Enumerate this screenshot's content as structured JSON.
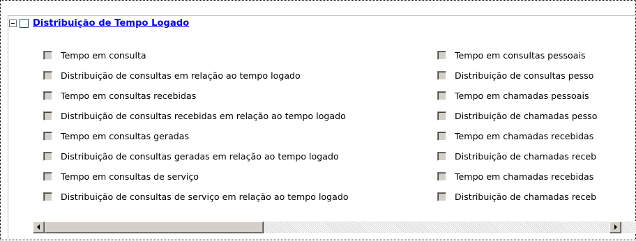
{
  "header": {
    "title": "Distribuição de Tempo Logado"
  },
  "columns": [
    {
      "items": [
        {
          "label": "Tempo em consulta",
          "checked": false
        },
        {
          "label": "Distribuição de consultas em relação ao tempo logado",
          "checked": false
        },
        {
          "label": "Tempo em consultas recebidas",
          "checked": false
        },
        {
          "label": "Distribuição de consultas recebidas em relação ao tempo logado",
          "checked": false
        },
        {
          "label": "Tempo em consultas geradas",
          "checked": false
        },
        {
          "label": "Distribuição de consultas geradas em relação ao tempo logado",
          "checked": false
        },
        {
          "label": "Tempo em consultas de serviço",
          "checked": false
        },
        {
          "label": "Distribuição de consultas de serviço em relação ao tempo logado",
          "checked": false
        }
      ]
    },
    {
      "items": [
        {
          "label": "Tempo em consultas pessoais",
          "checked": false
        },
        {
          "label": "Distribuição de consultas pesso",
          "checked": false
        },
        {
          "label": "Tempo em chamadas pessoais",
          "checked": false
        },
        {
          "label": "Distribuição de chamadas pesso",
          "checked": false
        },
        {
          "label": "Tempo em chamadas recebidas",
          "checked": false
        },
        {
          "label": "Distribuição de chamadas receb",
          "checked": false
        },
        {
          "label": "Tempo em chamadas recebidas",
          "checked": false
        },
        {
          "label": "Distribuição de chamadas receb",
          "checked": false
        }
      ]
    }
  ],
  "scrollbar": {
    "left_icon": "arrow-left-icon",
    "right_icon": "arrow-right-icon"
  },
  "colors": {
    "link": "#0000ff",
    "checkbox_disabled": "#d4d0c8",
    "border": "#c0c0c0"
  }
}
